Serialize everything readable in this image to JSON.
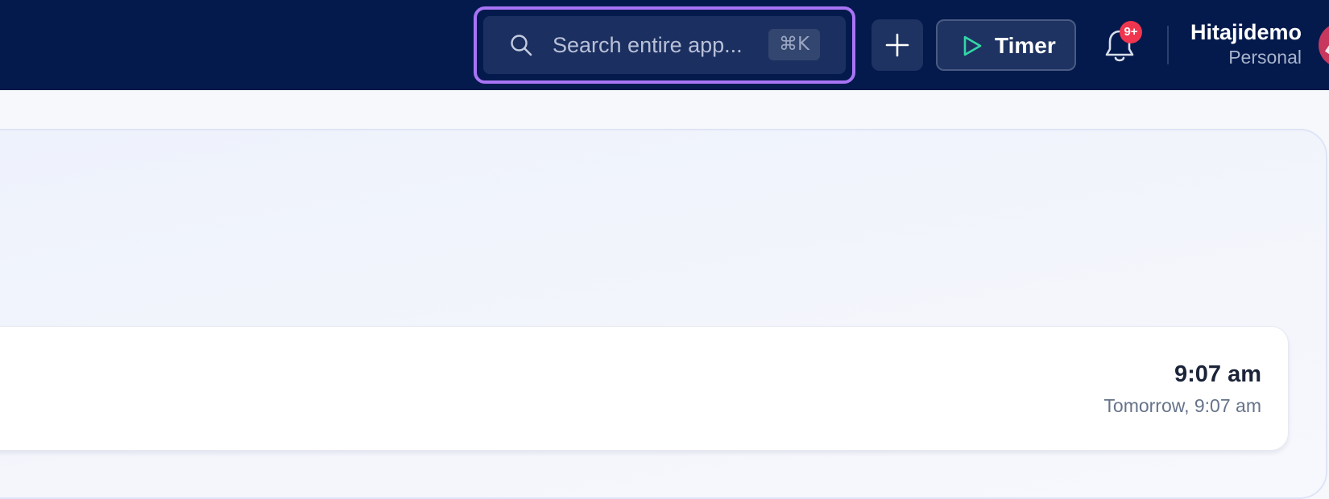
{
  "header": {
    "search": {
      "placeholder": "Search entire app...",
      "value": "",
      "shortcut": "⌘K"
    },
    "add_button": {
      "icon": "plus-icon"
    },
    "timer_button": {
      "label": "Timer",
      "icon": "play-icon"
    },
    "notifications": {
      "icon": "bell-icon",
      "badge": "9+"
    },
    "user": {
      "name": "Hitajidemo",
      "account_type": "Personal"
    }
  },
  "main": {
    "time_card": {
      "time": "9:07 am",
      "detail": "Tomorrow, 9:07 am"
    }
  },
  "colors": {
    "topbar": "#041a4c",
    "focus_ring": "#a874f5",
    "accent_green": "#33d6a6",
    "badge_red": "#f0364f"
  }
}
